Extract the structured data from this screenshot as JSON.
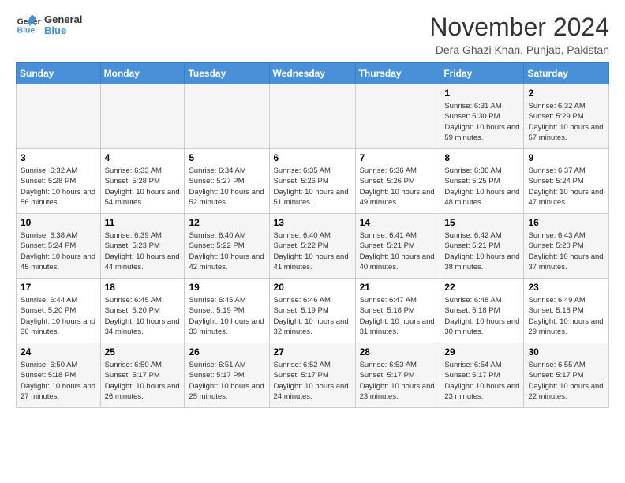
{
  "logo": {
    "line1": "General",
    "line2": "Blue"
  },
  "title": "November 2024",
  "location": "Dera Ghazi Khan, Punjab, Pakistan",
  "days_of_week": [
    "Sunday",
    "Monday",
    "Tuesday",
    "Wednesday",
    "Thursday",
    "Friday",
    "Saturday"
  ],
  "weeks": [
    [
      {
        "day": "",
        "info": ""
      },
      {
        "day": "",
        "info": ""
      },
      {
        "day": "",
        "info": ""
      },
      {
        "day": "",
        "info": ""
      },
      {
        "day": "",
        "info": ""
      },
      {
        "day": "1",
        "info": "Sunrise: 6:31 AM\nSunset: 5:30 PM\nDaylight: 10 hours and 59 minutes."
      },
      {
        "day": "2",
        "info": "Sunrise: 6:32 AM\nSunset: 5:29 PM\nDaylight: 10 hours and 57 minutes."
      }
    ],
    [
      {
        "day": "3",
        "info": "Sunrise: 6:32 AM\nSunset: 5:28 PM\nDaylight: 10 hours and 56 minutes."
      },
      {
        "day": "4",
        "info": "Sunrise: 6:33 AM\nSunset: 5:28 PM\nDaylight: 10 hours and 54 minutes."
      },
      {
        "day": "5",
        "info": "Sunrise: 6:34 AM\nSunset: 5:27 PM\nDaylight: 10 hours and 52 minutes."
      },
      {
        "day": "6",
        "info": "Sunrise: 6:35 AM\nSunset: 5:26 PM\nDaylight: 10 hours and 51 minutes."
      },
      {
        "day": "7",
        "info": "Sunrise: 6:36 AM\nSunset: 5:26 PM\nDaylight: 10 hours and 49 minutes."
      },
      {
        "day": "8",
        "info": "Sunrise: 6:36 AM\nSunset: 5:25 PM\nDaylight: 10 hours and 48 minutes."
      },
      {
        "day": "9",
        "info": "Sunrise: 6:37 AM\nSunset: 5:24 PM\nDaylight: 10 hours and 47 minutes."
      }
    ],
    [
      {
        "day": "10",
        "info": "Sunrise: 6:38 AM\nSunset: 5:24 PM\nDaylight: 10 hours and 45 minutes."
      },
      {
        "day": "11",
        "info": "Sunrise: 6:39 AM\nSunset: 5:23 PM\nDaylight: 10 hours and 44 minutes."
      },
      {
        "day": "12",
        "info": "Sunrise: 6:40 AM\nSunset: 5:22 PM\nDaylight: 10 hours and 42 minutes."
      },
      {
        "day": "13",
        "info": "Sunrise: 6:40 AM\nSunset: 5:22 PM\nDaylight: 10 hours and 41 minutes."
      },
      {
        "day": "14",
        "info": "Sunrise: 6:41 AM\nSunset: 5:21 PM\nDaylight: 10 hours and 40 minutes."
      },
      {
        "day": "15",
        "info": "Sunrise: 6:42 AM\nSunset: 5:21 PM\nDaylight: 10 hours and 38 minutes."
      },
      {
        "day": "16",
        "info": "Sunrise: 6:43 AM\nSunset: 5:20 PM\nDaylight: 10 hours and 37 minutes."
      }
    ],
    [
      {
        "day": "17",
        "info": "Sunrise: 6:44 AM\nSunset: 5:20 PM\nDaylight: 10 hours and 36 minutes."
      },
      {
        "day": "18",
        "info": "Sunrise: 6:45 AM\nSunset: 5:20 PM\nDaylight: 10 hours and 34 minutes."
      },
      {
        "day": "19",
        "info": "Sunrise: 6:45 AM\nSunset: 5:19 PM\nDaylight: 10 hours and 33 minutes."
      },
      {
        "day": "20",
        "info": "Sunrise: 6:46 AM\nSunset: 5:19 PM\nDaylight: 10 hours and 32 minutes."
      },
      {
        "day": "21",
        "info": "Sunrise: 6:47 AM\nSunset: 5:18 PM\nDaylight: 10 hours and 31 minutes."
      },
      {
        "day": "22",
        "info": "Sunrise: 6:48 AM\nSunset: 5:18 PM\nDaylight: 10 hours and 30 minutes."
      },
      {
        "day": "23",
        "info": "Sunrise: 6:49 AM\nSunset: 5:18 PM\nDaylight: 10 hours and 29 minutes."
      }
    ],
    [
      {
        "day": "24",
        "info": "Sunrise: 6:50 AM\nSunset: 5:18 PM\nDaylight: 10 hours and 27 minutes."
      },
      {
        "day": "25",
        "info": "Sunrise: 6:50 AM\nSunset: 5:17 PM\nDaylight: 10 hours and 26 minutes."
      },
      {
        "day": "26",
        "info": "Sunrise: 6:51 AM\nSunset: 5:17 PM\nDaylight: 10 hours and 25 minutes."
      },
      {
        "day": "27",
        "info": "Sunrise: 6:52 AM\nSunset: 5:17 PM\nDaylight: 10 hours and 24 minutes."
      },
      {
        "day": "28",
        "info": "Sunrise: 6:53 AM\nSunset: 5:17 PM\nDaylight: 10 hours and 23 minutes."
      },
      {
        "day": "29",
        "info": "Sunrise: 6:54 AM\nSunset: 5:17 PM\nDaylight: 10 hours and 23 minutes."
      },
      {
        "day": "30",
        "info": "Sunrise: 6:55 AM\nSunset: 5:17 PM\nDaylight: 10 hours and 22 minutes."
      }
    ]
  ]
}
